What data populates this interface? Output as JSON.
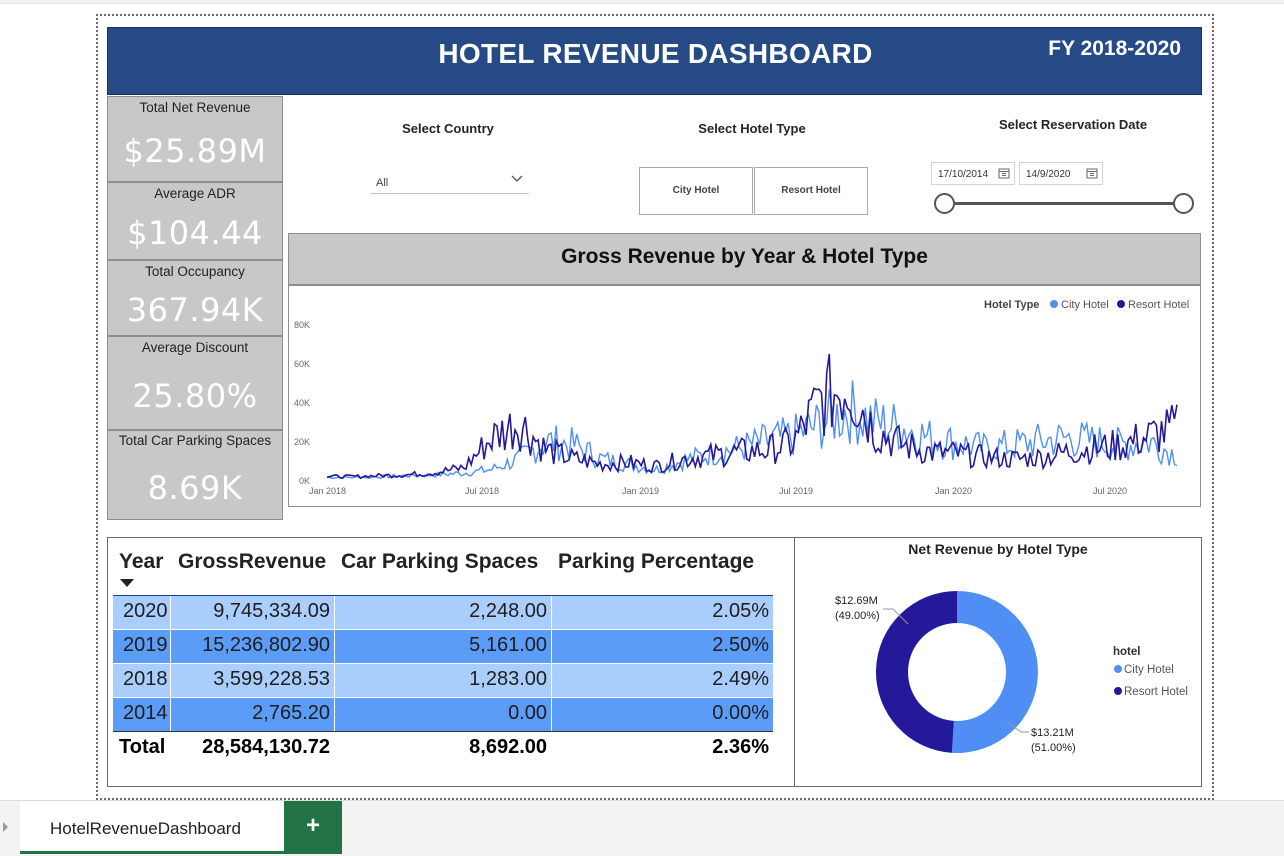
{
  "banner": {
    "title": "HOTEL REVENUE DASHBOARD",
    "fiscal_year": "FY 2018-2020",
    "color": "#254a86"
  },
  "kpis": [
    {
      "label": "Total Net Revenue",
      "value": "$25.89M"
    },
    {
      "label": "Average ADR",
      "value": "$104.44"
    },
    {
      "label": "Total Occupancy",
      "value": "367.94K"
    },
    {
      "label": "Average Discount",
      "value": "25.80%"
    },
    {
      "label": "Total Car Parking Spaces",
      "value": "8.69K"
    }
  ],
  "slicers": {
    "country": {
      "title": "Select Country",
      "value": "All"
    },
    "hotel_type": {
      "title": "Select Hotel Type",
      "options": [
        "City Hotel",
        "Resort Hotel"
      ]
    },
    "date": {
      "title": "Select Reservation Date",
      "start": "17/10/2014",
      "end": "14/9/2020"
    }
  },
  "line_chart": {
    "title": "Gross Revenue by Year & Hotel Type",
    "legend_title": "Hotel Type",
    "legend": [
      "City Hotel",
      "Resort Hotel"
    ],
    "y_ticks": [
      "80K",
      "60K",
      "40K",
      "20K",
      "0K"
    ],
    "x_ticks": [
      "Jan 2018",
      "Jul 2018",
      "Jan 2019",
      "Jul 2019",
      "Jan 2020",
      "Jul 2020"
    ]
  },
  "table": {
    "headers": [
      "Year",
      "GrossRevenue",
      "Car Parking Spaces",
      "Parking Percentage"
    ],
    "rows": [
      [
        "2020",
        "9,745,334.09",
        "2,248.00",
        "2.05%"
      ],
      [
        "2019",
        "15,236,802.90",
        "5,161.00",
        "2.50%"
      ],
      [
        "2018",
        "3,599,228.53",
        "1,283.00",
        "2.49%"
      ],
      [
        "2014",
        "2,765.20",
        "0.00",
        "0.00%"
      ]
    ],
    "total": [
      "Total",
      "28,584,130.72",
      "8,692.00",
      "2.36%"
    ]
  },
  "donut": {
    "title": "Net Revenue by Hotel Type",
    "legend_title": "hotel",
    "legend": [
      "City Hotel",
      "Resort Hotel"
    ],
    "labels": {
      "resort_value": "$12.69M",
      "resort_pct": "(49.00%)",
      "city_value": "$13.21M",
      "city_pct": "(51.00%)"
    }
  },
  "tabs": {
    "active": "HotelRevenueDashboard",
    "add": "+"
  },
  "colors": {
    "city": "#4f8ff5",
    "resort": "#23199a",
    "kpi_bg": "#c8c8c8",
    "row_light": "#a9cdfd",
    "row_dark": "#5b9cf8",
    "excel_green": "#217346"
  },
  "chart_data": [
    {
      "type": "line",
      "title": "Gross Revenue by Year & Hotel Type",
      "xlabel": "",
      "ylabel": "",
      "x_ticks": [
        "Jan 2018",
        "Jul 2018",
        "Jan 2019",
        "Jul 2019",
        "Jan 2020",
        "Jul 2020"
      ],
      "ylim": [
        0,
        80000
      ],
      "legend_position": "top-right",
      "series": [
        {
          "name": "City Hotel",
          "x": [
            "Jan 2018",
            "Feb 2018",
            "Mar 2018",
            "Apr 2018",
            "May 2018",
            "Jun 2018",
            "Jul 2018",
            "Aug 2018",
            "Sep 2018",
            "Oct 2018",
            "Nov 2018",
            "Dec 2018",
            "Jan 2019",
            "Feb 2019",
            "Mar 2019",
            "Apr 2019",
            "May 2019",
            "Jun 2019",
            "Jul 2019",
            "Aug 2019",
            "Sep 2019",
            "Oct 2019",
            "Nov 2019",
            "Dec 2019",
            "Jan 2020",
            "Feb 2020",
            "Mar 2020",
            "Apr 2020",
            "May 2020",
            "Jun 2020",
            "Jul 2020",
            "Aug 2020"
          ],
          "values": [
            1500,
            1500,
            2000,
            2500,
            3000,
            4000,
            6000,
            12000,
            22000,
            20000,
            12000,
            9000,
            6000,
            11000,
            15000,
            18000,
            22000,
            25000,
            32000,
            40000,
            33000,
            30000,
            24000,
            21000,
            18000,
            20000,
            22000,
            24000,
            22000,
            20000,
            22000,
            14000
          ]
        },
        {
          "name": "Resort Hotel",
          "x": [
            "Jan 2018",
            "Feb 2018",
            "Mar 2018",
            "Apr 2018",
            "May 2018",
            "Jun 2018",
            "Jul 2018",
            "Aug 2018",
            "Sep 2018",
            "Oct 2018",
            "Nov 2018",
            "Dec 2018",
            "Jan 2019",
            "Feb 2019",
            "Mar 2019",
            "Apr 2019",
            "May 2019",
            "Jun 2019",
            "Jul 2019",
            "Aug 2019",
            "Sep 2019",
            "Oct 2019",
            "Nov 2019",
            "Dec 2019",
            "Jan 2020",
            "Feb 2020",
            "Mar 2020",
            "Apr 2020",
            "May 2020",
            "Jun 2020",
            "Jul 2020",
            "Aug 2020"
          ],
          "values": [
            2000,
            2000,
            2500,
            3000,
            4500,
            7000,
            24000,
            33000,
            17000,
            12000,
            9000,
            10000,
            8000,
            12000,
            14000,
            16000,
            17000,
            21000,
            45000,
            55000,
            28000,
            20000,
            16000,
            15000,
            13000,
            12000,
            13000,
            16000,
            18000,
            20000,
            25000,
            30000
          ]
        }
      ]
    },
    {
      "type": "pie",
      "title": "Net Revenue by Hotel Type",
      "categories": [
        "City Hotel",
        "Resort Hotel"
      ],
      "values": [
        13.21,
        12.69
      ],
      "unit": "$M",
      "percent": [
        51.0,
        49.0
      ]
    },
    {
      "type": "table",
      "columns": [
        "Year",
        "GrossRevenue",
        "Car Parking Spaces",
        "Parking Percentage"
      ],
      "rows": [
        [
          2020,
          9745334.09,
          2248.0,
          2.05
        ],
        [
          2019,
          15236802.9,
          5161.0,
          2.5
        ],
        [
          2018,
          3599228.53,
          1283.0,
          2.49
        ],
        [
          2014,
          2765.2,
          0.0,
          0.0
        ]
      ],
      "total": [
        "Total",
        28584130.72,
        8692.0,
        2.36
      ]
    }
  ]
}
